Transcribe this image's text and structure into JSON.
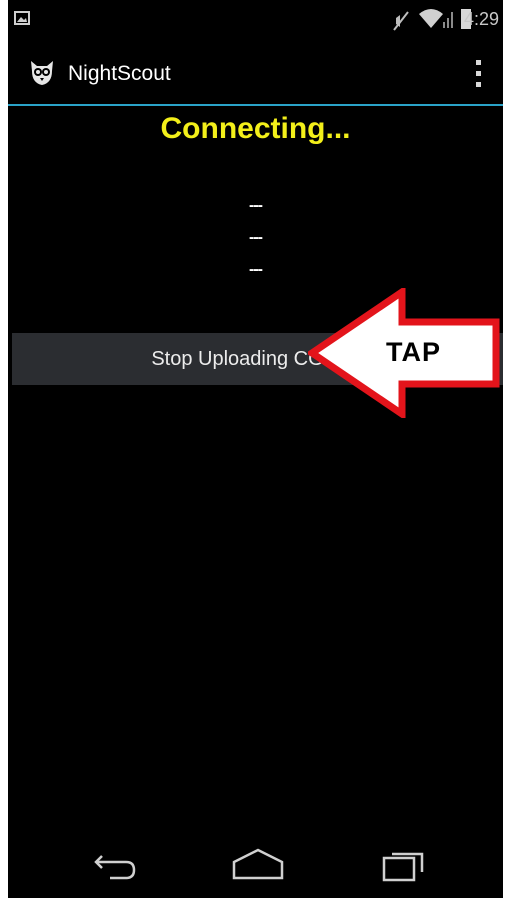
{
  "status_bar": {
    "time": "4:29",
    "icons": [
      "image-notification-icon",
      "mute-icon",
      "wifi-icon",
      "signal-icon",
      "battery-icon"
    ]
  },
  "action_bar": {
    "title": "NightScout",
    "accent_color": "#2aa3c8"
  },
  "main": {
    "status_text": "Connecting...",
    "status_color": "#f3ef1a",
    "readings": [
      "---",
      "---",
      "---"
    ],
    "stop_button_label": "Stop Uploading CG"
  },
  "annotation": {
    "label": "TAP",
    "arrow_color": "#e3141b"
  },
  "nav_bar": {
    "buttons": [
      "back-icon",
      "home-icon",
      "recent-apps-icon"
    ]
  }
}
